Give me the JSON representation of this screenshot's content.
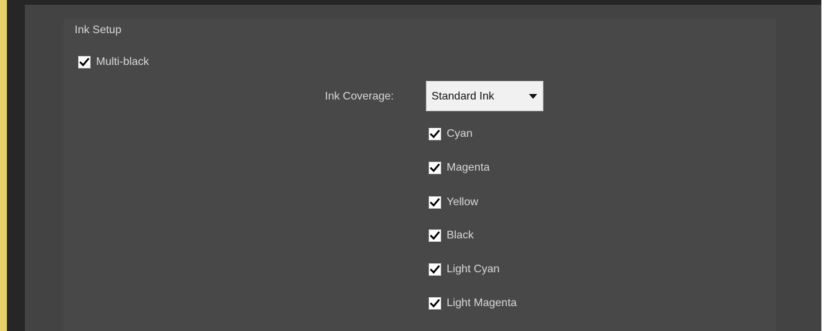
{
  "section": {
    "title": "Ink Setup"
  },
  "multi_black": {
    "label": "Multi-black",
    "checked": true
  },
  "ink_coverage": {
    "label": "Ink Coverage:",
    "selected": "Standard Ink"
  },
  "inks": [
    {
      "label": "Cyan",
      "checked": true
    },
    {
      "label": "Magenta",
      "checked": true
    },
    {
      "label": "Yellow",
      "checked": true
    },
    {
      "label": "Black",
      "checked": true
    },
    {
      "label": "Light Cyan",
      "checked": true
    },
    {
      "label": "Light Magenta",
      "checked": true
    }
  ],
  "icons": {
    "checkbox": "checkmark-icon",
    "dropdown": "chevron-down-icon"
  },
  "colors": {
    "accent": "#e8cf6a",
    "panel": "#484848",
    "text": "#d8d8d8"
  }
}
